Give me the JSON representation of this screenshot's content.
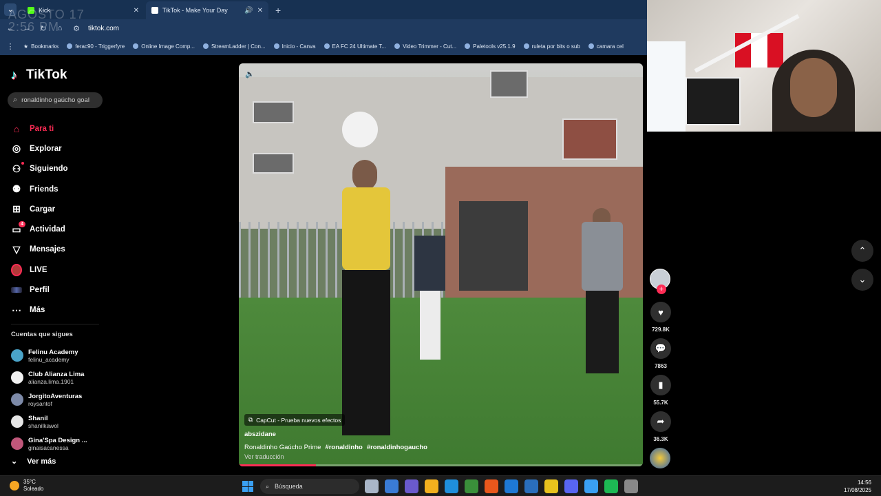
{
  "browser": {
    "tabs": [
      {
        "title": "Kick",
        "color": "#53fc18",
        "active": false
      },
      {
        "title": "TikTok - Make Your Day",
        "color": "#ffffff",
        "active": true
      }
    ],
    "url": "tiktok.com",
    "watermark_line1": "AGOSTO 17",
    "watermark_line2": "2:56 PM",
    "bookmarks": [
      "Bookmarks",
      "ferac90 - Triggerfyre",
      "Online Image Comp...",
      "StreamLadder | Con...",
      "Inicio - Canva",
      "EA FC 24 Ultimate T...",
      "Video Trimmer - Cut...",
      "Paletools v25.1.9",
      "ruleta por bits o sub",
      "camara cel"
    ]
  },
  "sidebar": {
    "logo": "TikTok",
    "search_value": "ronaldinho gaúcho goal",
    "nav": [
      {
        "label": "Para ti",
        "icon": "⌂",
        "active": true
      },
      {
        "label": "Explorar",
        "icon": "◎"
      },
      {
        "label": "Siguiendo",
        "icon": "👤",
        "dot": true
      },
      {
        "label": "Friends",
        "icon": "👥"
      },
      {
        "label": "Cargar",
        "icon": "⊞"
      },
      {
        "label": "Actividad",
        "icon": "▭",
        "badge": "4"
      },
      {
        "label": "Mensajes",
        "icon": "▽"
      },
      {
        "label": "LIVE",
        "icon": "live"
      },
      {
        "label": "Perfil",
        "icon": "profile"
      },
      {
        "label": "Más",
        "icon": "⋯"
      }
    ],
    "following_title": "Cuentas que sigues",
    "accounts": [
      {
        "name": "Felinu Academy",
        "handle": "felinu_academy",
        "color": "#4aa3c8"
      },
      {
        "name": "Club Alianza Lima",
        "handle": "alianza.lima.1901",
        "color": "#f2f2f2"
      },
      {
        "name": "JorgitoAventuras",
        "handle": "roysantof",
        "color": "#7d8aa8"
      },
      {
        "name": "Shanil",
        "handle": "shanilkawol",
        "color": "#e6e6e6"
      },
      {
        "name": "Gina'Spa Design ...",
        "handle": "ginaisacanessa",
        "color": "#c0577a"
      }
    ],
    "see_more": "Ver más"
  },
  "video": {
    "effect": "CapCut - Prueba nuevos efectos",
    "author": "abszidane",
    "caption": "Ronaldinho Gaúcho Prime",
    "hashtags": [
      "#ronaldinho",
      "#ronaldinhogaucho"
    ],
    "translate": "Ver traducción",
    "progress": 0.19
  },
  "actions": {
    "likes": "729.8K",
    "comments": "7863",
    "saves": "55.7K",
    "shares": "36.3K"
  },
  "taskbar": {
    "temp": "35°C",
    "weather": "Soleado",
    "search": "Búsqueda",
    "time": "14:56",
    "date": "17/08/2025",
    "app_colors": [
      "#a9b6c8",
      "#3a7bd5",
      "#6a5acd",
      "#f2b01e",
      "#1f8fdc",
      "#3a8f3a",
      "#e8571c",
      "#1e78d4",
      "#2a6ebb",
      "#e8c21d",
      "#5865f2",
      "#3aa0f3",
      "#1db954",
      "#888888"
    ]
  }
}
